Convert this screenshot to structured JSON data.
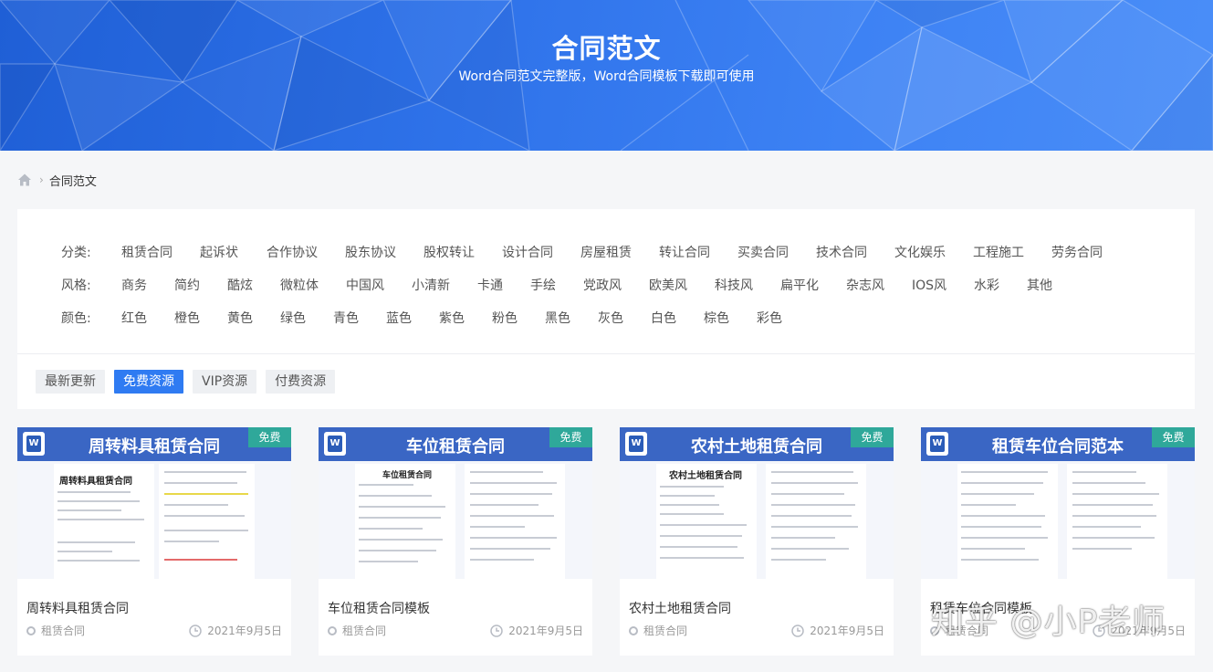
{
  "banner": {
    "title": "合同范文",
    "subtitle": "Word合同范文完整版，Word合同模板下载即可使用"
  },
  "breadcrumb": {
    "icon": "home-icon",
    "current": "合同范文"
  },
  "filters": {
    "category": {
      "label": "分类:",
      "options": [
        "租赁合同",
        "起诉状",
        "合作协议",
        "股东协议",
        "股权转让",
        "设计合同",
        "房屋租赁",
        "转让合同",
        "买卖合同",
        "技术合同",
        "文化娱乐",
        "工程施工",
        "劳务合同"
      ]
    },
    "style": {
      "label": "风格:",
      "options": [
        "商务",
        "简约",
        "酷炫",
        "微粒体",
        "中国风",
        "小清新",
        "卡通",
        "手绘",
        "党政风",
        "欧美风",
        "科技风",
        "扁平化",
        "杂志风",
        "IOS风",
        "水彩",
        "其他"
      ]
    },
    "color": {
      "label": "颜色:",
      "options": [
        "红色",
        "橙色",
        "黄色",
        "绿色",
        "青色",
        "蓝色",
        "紫色",
        "粉色",
        "黑色",
        "灰色",
        "白色",
        "棕色",
        "彩色"
      ]
    }
  },
  "tabs": [
    {
      "label": "最新更新",
      "active": false
    },
    {
      "label": "免费资源",
      "active": true
    },
    {
      "label": "VIP资源",
      "active": false
    },
    {
      "label": "付费资源",
      "active": false
    }
  ],
  "cards": [
    {
      "thumb_title": "周转料具租赁合同",
      "badge": "免费",
      "doc_title": "周转料具租赁合同",
      "name": "周转料具租赁合同",
      "category": "租赁合同",
      "date": "2021年9月5日"
    },
    {
      "thumb_title": "车位租赁合同",
      "badge": "免费",
      "doc_title": "车位租赁合同",
      "name": "车位租赁合同模板",
      "category": "租赁合同",
      "date": "2021年9月5日"
    },
    {
      "thumb_title": "农村土地租赁合同",
      "badge": "免费",
      "doc_title": "农村土地租赁合同",
      "name": "农村土地租赁合同",
      "category": "租赁合同",
      "date": "2021年9月5日"
    },
    {
      "thumb_title": "租赁车位合同范本",
      "badge": "免费",
      "doc_title": "",
      "name": "租赁车位合同模板",
      "category": "租赁合同",
      "date": "2021年9月5日"
    }
  ],
  "watermark": "知乎 @小P老师",
  "colors": {
    "banner": "#2f73ea",
    "accent": "#2f7bf2",
    "badge": "#2fa89a",
    "thumb_header": "#3a66c4"
  }
}
